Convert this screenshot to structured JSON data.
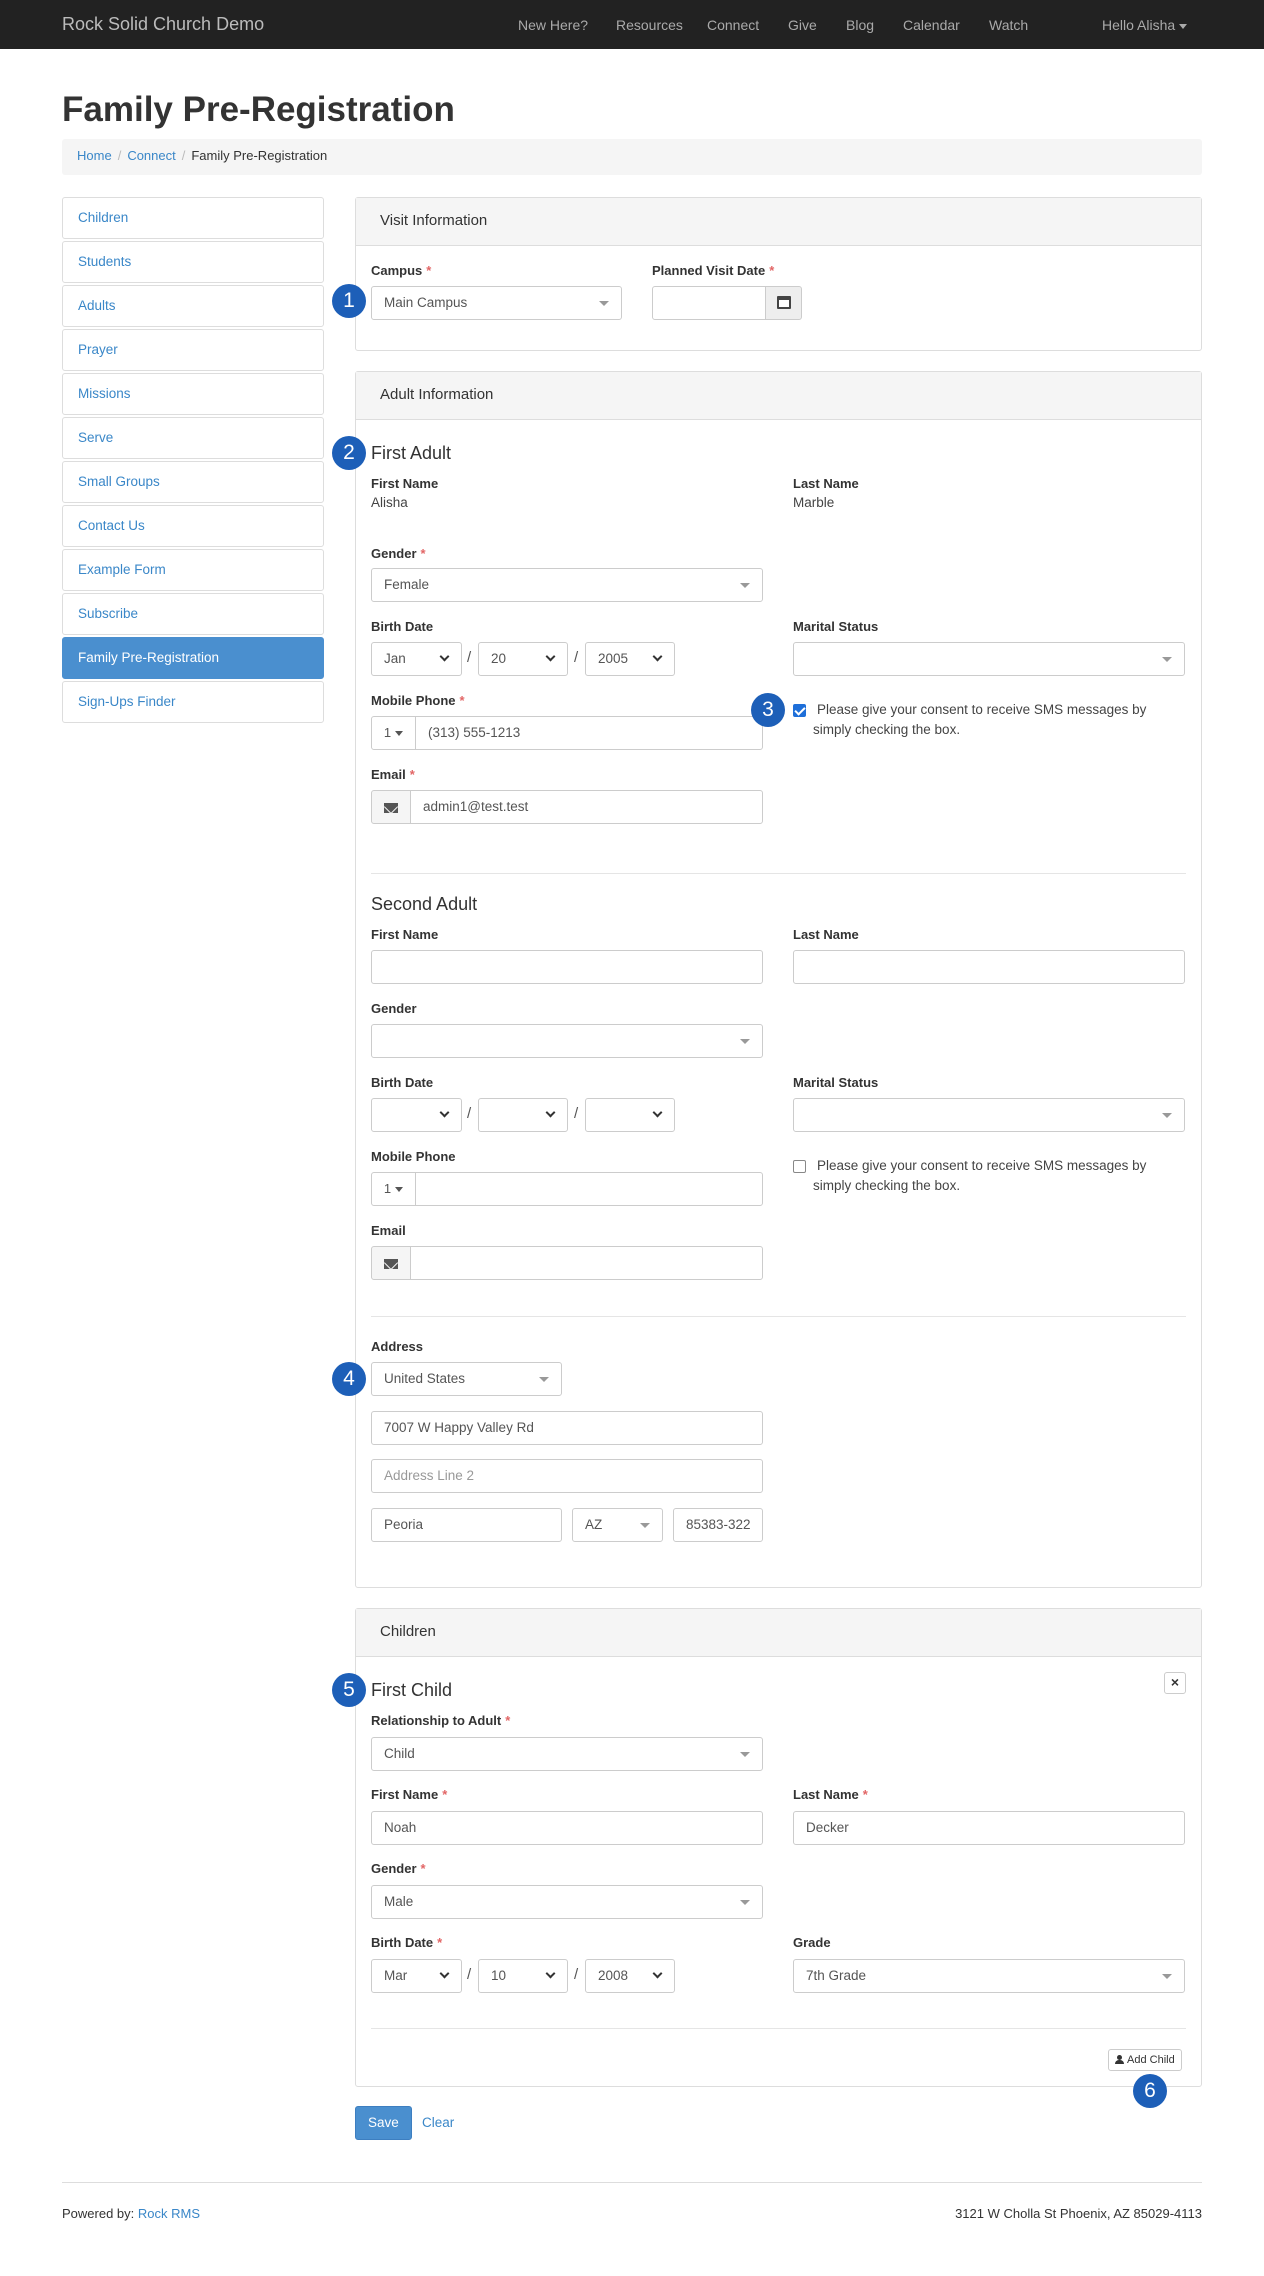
{
  "navbar": {
    "brand": "Rock Solid Church Demo",
    "items": [
      "New Here?",
      "Resources",
      "Connect",
      "Give",
      "Blog",
      "Calendar",
      "Watch"
    ],
    "user": "Hello Alisha"
  },
  "page": {
    "title": "Family Pre-Registration",
    "breadcrumb": [
      "Home",
      "Connect",
      "Family Pre-Registration"
    ]
  },
  "sidebar": {
    "items": [
      "Children",
      "Students",
      "Adults",
      "Prayer",
      "Missions",
      "Serve",
      "Small Groups",
      "Contact Us",
      "Example Form",
      "Subscribe",
      "Family Pre-Registration",
      "Sign-Ups Finder"
    ],
    "active": "Family Pre-Registration"
  },
  "visit": {
    "heading": "Visit Information",
    "campus_label": "Campus",
    "campus_value": "Main Campus",
    "date_label": "Planned Visit Date",
    "date_value": ""
  },
  "adults": {
    "heading": "Adult Information",
    "first": {
      "heading": "First Adult",
      "first_name_label": "First Name",
      "first_name": "Alisha",
      "last_name_label": "Last Name",
      "last_name": "Marble",
      "gender_label": "Gender",
      "gender": "Female",
      "birth_label": "Birth Date",
      "birth_month": "Jan",
      "birth_day": "20",
      "birth_year": "2005",
      "marital_label": "Marital Status",
      "marital": "",
      "phone_label": "Mobile Phone",
      "phone_code": "1",
      "phone": "(313) 555-1213",
      "sms_line1": "Please give your consent to receive SMS messages by",
      "sms_line2": "simply checking the box.",
      "sms_checked": true,
      "email_label": "Email",
      "email": "admin1@test.test"
    },
    "second": {
      "heading": "Second Adult",
      "first_name_label": "First Name",
      "last_name_label": "Last Name",
      "gender_label": "Gender",
      "birth_label": "Birth Date",
      "marital_label": "Marital Status",
      "phone_label": "Mobile Phone",
      "phone_code": "1",
      "sms_line1": "Please give your consent to receive SMS messages by",
      "sms_line2": "simply checking the box.",
      "sms_checked": false,
      "email_label": "Email"
    },
    "address": {
      "label": "Address",
      "country": "United States",
      "line1": "7007 W Happy Valley Rd",
      "line2_placeholder": "Address Line 2",
      "city": "Peoria",
      "state": "AZ",
      "zip": "85383-322"
    }
  },
  "children": {
    "heading": "Children",
    "first": {
      "heading": "First Child",
      "relationship_label": "Relationship to Adult",
      "relationship": "Child",
      "first_name_label": "First Name",
      "first_name": "Noah",
      "last_name_label": "Last Name",
      "last_name": "Decker",
      "gender_label": "Gender",
      "gender": "Male",
      "birth_label": "Birth Date",
      "birth_month": "Mar",
      "birth_day": "10",
      "birth_year": "2008",
      "grade_label": "Grade",
      "grade": "7th Grade",
      "close": "×"
    },
    "add_child": "Add Child"
  },
  "actions": {
    "save": "Save",
    "clear": "Clear"
  },
  "footer": {
    "powered_by": "Powered by:",
    "powered_link": "Rock RMS",
    "address": "3121 W Cholla St Phoenix, AZ 85029-4113"
  },
  "callouts": [
    "1",
    "2",
    "3",
    "4",
    "5",
    "6"
  ],
  "colors": {
    "navbar": "#222222",
    "accent": "#4a8fcf",
    "link": "#3a87c8",
    "callout": "#1d5fb8",
    "required": "#e26565"
  }
}
